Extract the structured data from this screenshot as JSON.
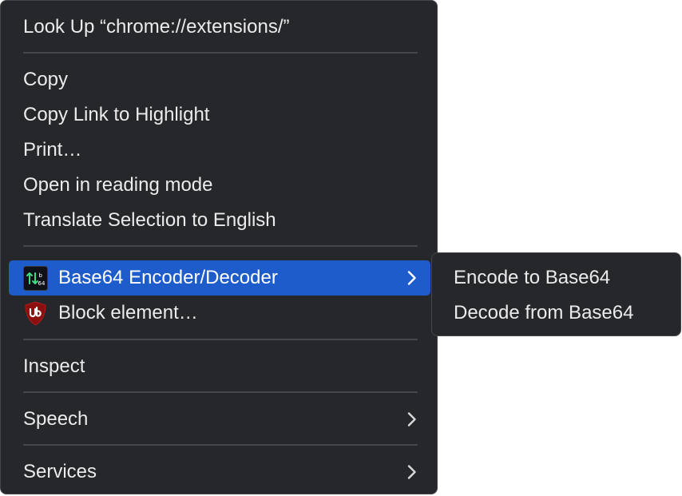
{
  "context_menu": {
    "items": [
      {
        "label": "Look Up “chrome://extensions/”"
      },
      {
        "label": "Copy"
      },
      {
        "label": "Copy Link to Highlight"
      },
      {
        "label": "Print…"
      },
      {
        "label": "Open in reading mode"
      },
      {
        "label": "Translate Selection to English"
      },
      {
        "label": "Base64 Encoder/Decoder",
        "icon": "base64-extension-icon",
        "has_submenu": true,
        "highlighted": true
      },
      {
        "label": "Block element…",
        "icon": "ublock-origin-icon"
      },
      {
        "label": "Inspect"
      },
      {
        "label": "Speech",
        "has_submenu": true
      },
      {
        "label": "Services",
        "has_submenu": true
      }
    ]
  },
  "submenu": {
    "items": [
      {
        "label": "Encode to Base64"
      },
      {
        "label": "Decode from Base64"
      }
    ]
  },
  "colors": {
    "menu_background": "#25272b",
    "highlight": "#1f5ccb",
    "text": "#ebebeb",
    "separator": "#45474b",
    "ublock_red": "#8b0f0f"
  },
  "icons": {
    "base64_icon_glyph": "64"
  }
}
